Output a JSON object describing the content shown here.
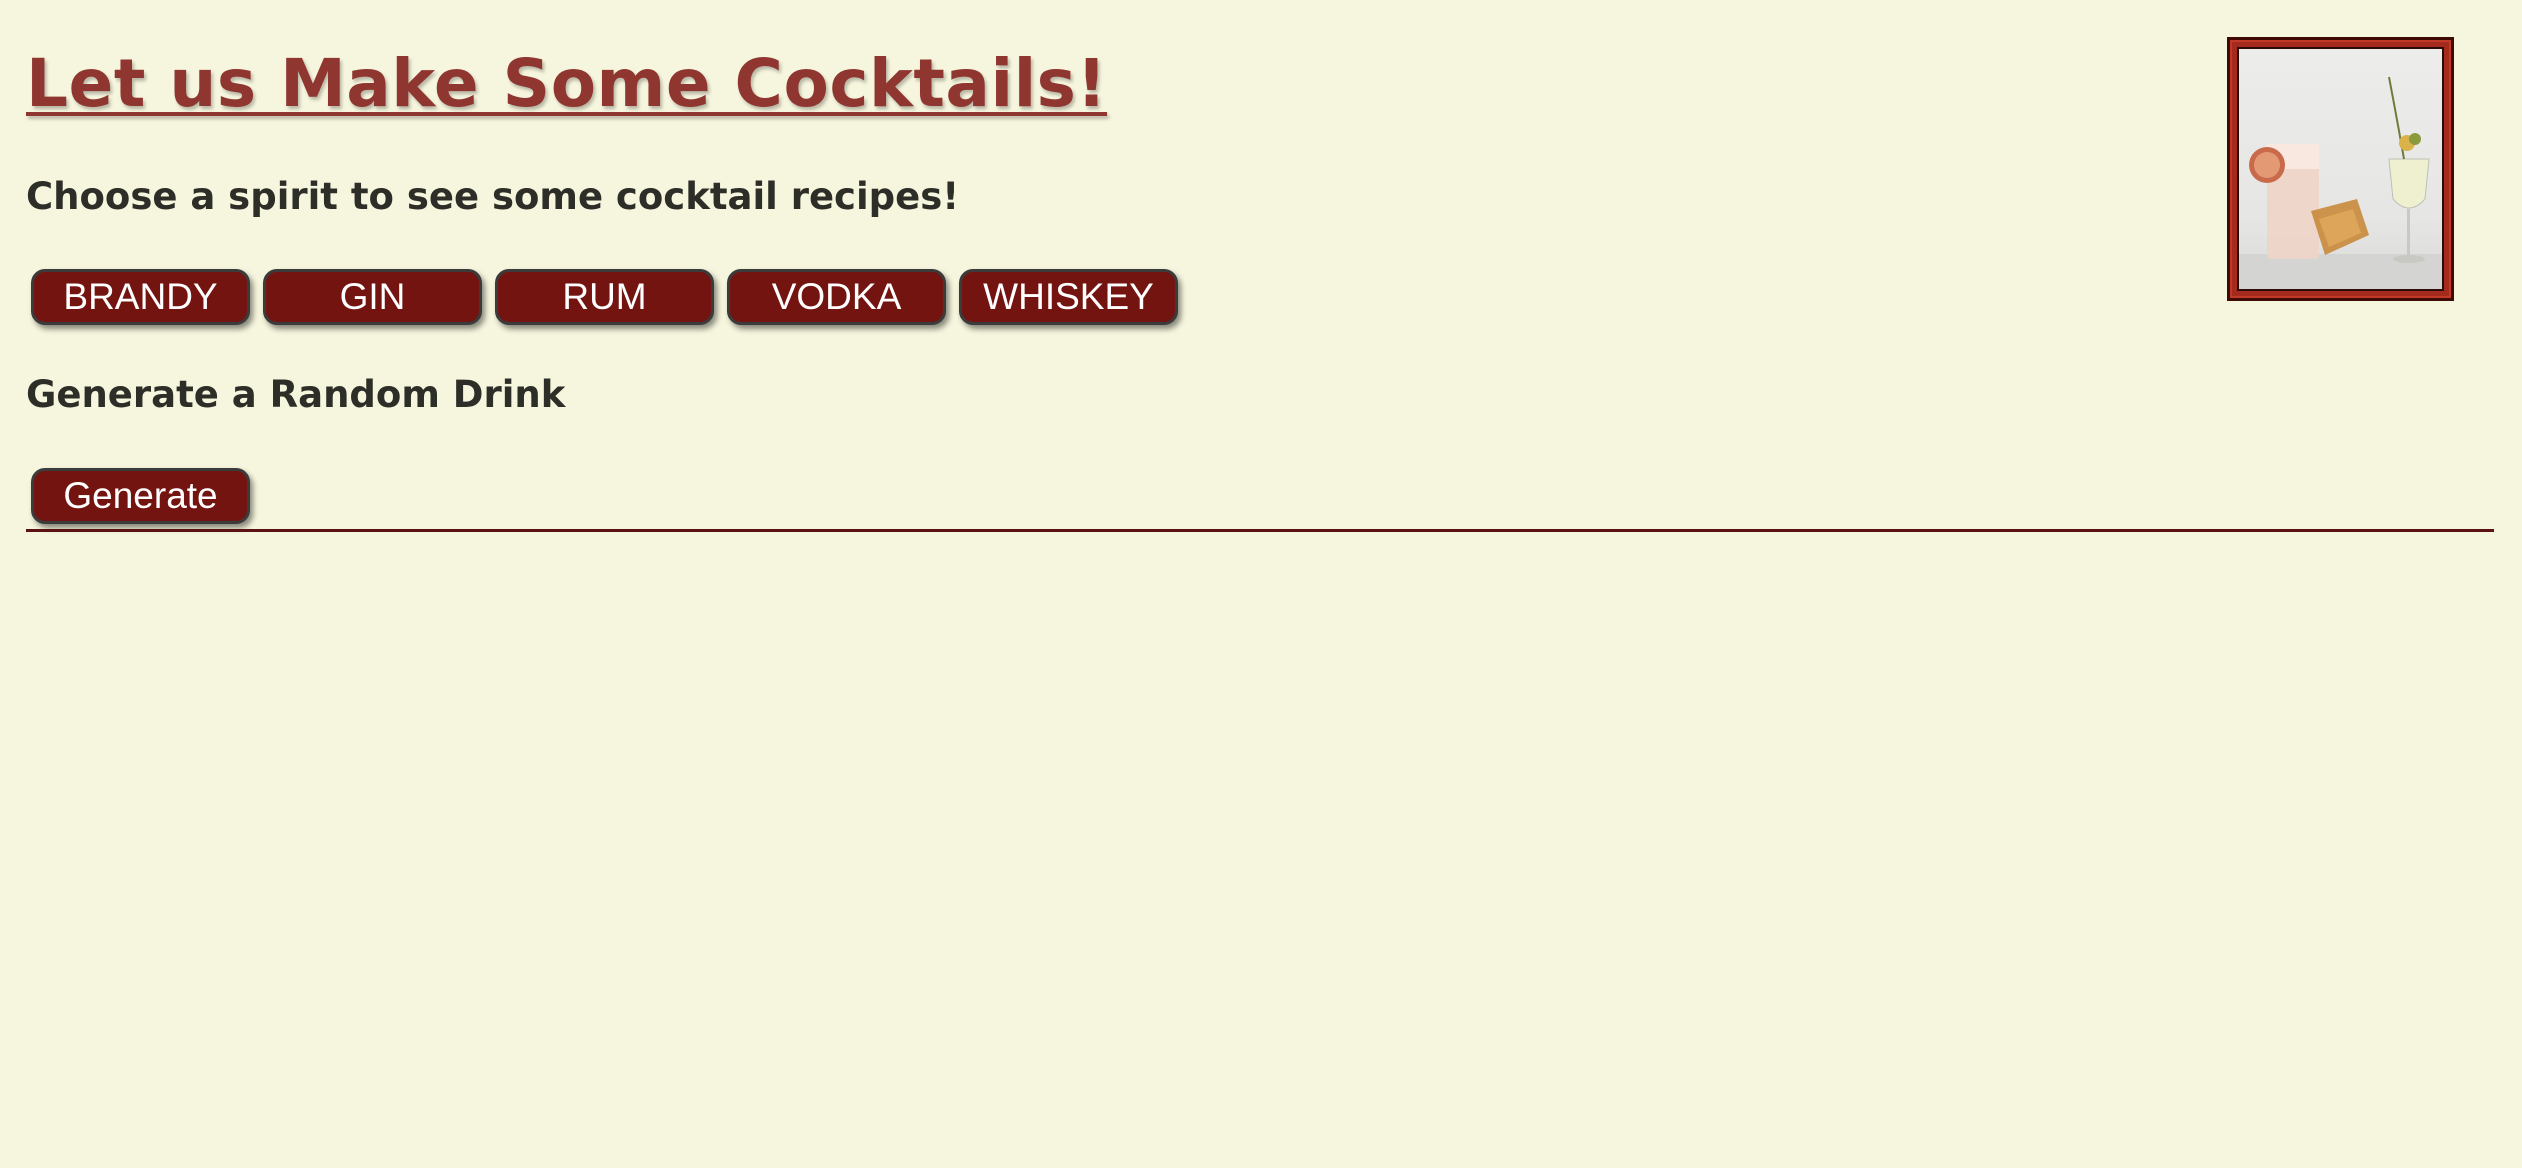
{
  "header": {
    "title": "Let us Make Some Cocktails!"
  },
  "spirits": {
    "prompt": "Choose a spirit to see some cocktail recipes!",
    "buttons": [
      {
        "label": "BRANDY"
      },
      {
        "label": "GIN"
      },
      {
        "label": "RUM"
      },
      {
        "label": "VODKA"
      },
      {
        "label": "WHISKEY"
      }
    ]
  },
  "random": {
    "prompt": "Generate a Random Drink",
    "button_label": "Generate"
  },
  "image": {
    "alt_subject": "cocktail-photo"
  },
  "colors": {
    "background": "#f6f5dd",
    "title": "#8f3631",
    "button": "#731410",
    "divider": "#5c1210",
    "frame": "#a32a1c"
  }
}
